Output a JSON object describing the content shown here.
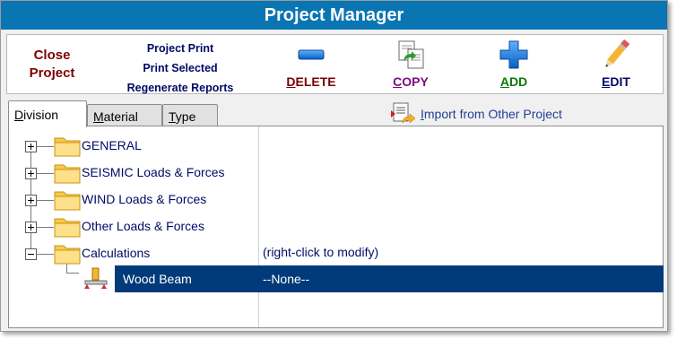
{
  "window": {
    "title": "Project Manager"
  },
  "toolbar": {
    "close_project": [
      "Close",
      "Project"
    ],
    "print_items": [
      "Project Print",
      "Print Selected",
      "Regenerate Reports"
    ],
    "delete": {
      "hotkey": "D",
      "rest": "ELETE",
      "color": "#7b0000",
      "icon": "minus-icon"
    },
    "copy": {
      "hotkey": "C",
      "rest": "OPY",
      "color": "#7a0b7e",
      "icon": "copy-icon"
    },
    "add": {
      "hotkey": "A",
      "rest": "DD",
      "color": "#0a7a0a",
      "icon": "plus-icon"
    },
    "edit": {
      "hotkey": "E",
      "rest": "DIT",
      "color": "#000a66",
      "icon": "pencil-icon"
    }
  },
  "tabs": [
    {
      "hotkey": "D",
      "rest": "ivision",
      "active": true
    },
    {
      "hotkey": "M",
      "rest": "aterial",
      "active": false
    },
    {
      "hotkey": "T",
      "rest": "ype",
      "active": false
    }
  ],
  "import": {
    "hotkey": "I",
    "rest": "mport from Other Project",
    "icon": "import-icon"
  },
  "tree": {
    "folders": [
      {
        "label": "GENERAL",
        "expanded": false
      },
      {
        "label": "SEISMIC Loads & Forces",
        "expanded": false
      },
      {
        "label": "WIND Loads & Forces",
        "expanded": false
      },
      {
        "label": "Other Loads & Forces",
        "expanded": false
      },
      {
        "label": "Calculations",
        "expanded": true,
        "description": "(right-click to modify)"
      }
    ],
    "selected_child": {
      "label": "Wood Beam",
      "description": "--None--",
      "icon": "wood-beam-icon"
    }
  },
  "colors": {
    "title_bar": "#0a75b3",
    "selection": "#003a79",
    "tree_text": "#000a66"
  }
}
